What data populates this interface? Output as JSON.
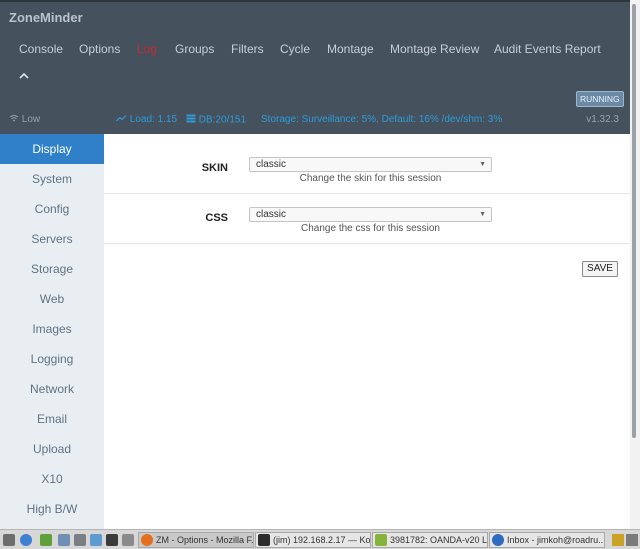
{
  "app": {
    "brand": "ZoneMinder"
  },
  "nav": {
    "items": [
      {
        "label": "Console",
        "active": false
      },
      {
        "label": "Options",
        "active": false
      },
      {
        "label": "Log",
        "active": true
      },
      {
        "label": "Groups",
        "active": false
      },
      {
        "label": "Filters",
        "active": false
      },
      {
        "label": "Cycle",
        "active": false
      },
      {
        "label": "Montage",
        "active": false
      },
      {
        "label": "Montage Review",
        "active": false
      },
      {
        "label": "Audit Events Report",
        "active": false
      }
    ],
    "collapse_icon": "chevron-up-icon"
  },
  "status": {
    "run_state": "RUNNING",
    "bandwidth": "Low",
    "load": "Load: 1.15",
    "db": "DB:20/151",
    "storage": "Storage: Surveillance: 5%, Default: 16% /dev/shm: 3%",
    "version": "v1.32.3",
    "colors": {
      "header_bg": "#45515c",
      "link": "#2f9bd8",
      "active_nav": "#c8292f"
    }
  },
  "sidebar": {
    "items": [
      {
        "label": "Display",
        "active": true
      },
      {
        "label": "System",
        "active": false
      },
      {
        "label": "Config",
        "active": false
      },
      {
        "label": "Servers",
        "active": false
      },
      {
        "label": "Storage",
        "active": false
      },
      {
        "label": "Web",
        "active": false
      },
      {
        "label": "Images",
        "active": false
      },
      {
        "label": "Logging",
        "active": false
      },
      {
        "label": "Network",
        "active": false
      },
      {
        "label": "Email",
        "active": false
      },
      {
        "label": "Upload",
        "active": false
      },
      {
        "label": "X10",
        "active": false
      },
      {
        "label": "High B/W",
        "active": false
      }
    ],
    "active_color": "#2f80c8"
  },
  "options": {
    "skin": {
      "label": "SKIN",
      "value": "classic",
      "help": "Change the skin for this session"
    },
    "css": {
      "label": "CSS",
      "value": "classic",
      "help": "Change the css for this session"
    },
    "save_label": "SAVE"
  },
  "taskbar": {
    "tasks": [
      {
        "label": "ZM - Options - Mozilla F...",
        "icon": "firefox-icon",
        "active": true
      },
      {
        "label": "(jim) 192.168.2.17 — Ko...",
        "icon": "terminal-icon",
        "active": false
      },
      {
        "label": "3981782: OANDA-v20 Li...",
        "icon": "document-icon",
        "active": false
      },
      {
        "label": "Inbox - jimkoh@roadru...",
        "icon": "mail-icon",
        "active": false
      }
    ]
  }
}
